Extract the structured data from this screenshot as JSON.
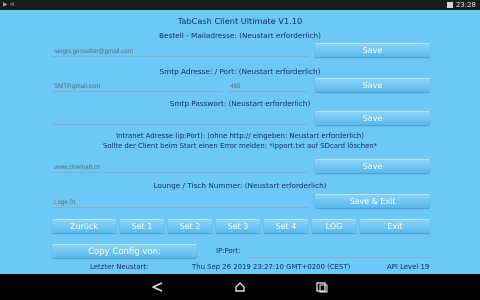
{
  "status_bar": {
    "left_icons": "▶ ⊲",
    "time": "23:28"
  },
  "title": "TabCash Client Ultimate V1.10",
  "email": {
    "label": "Bestell - Mailadresse: (Neustart erforderlich)",
    "value": "sergio.gensetter@gmail.com",
    "button": "Save"
  },
  "smtp": {
    "label": "Smtp Adresse: / Port: (Neustart erforderlich)",
    "address": "SMTP.gmail.com",
    "port": "465",
    "button": "Save"
  },
  "smtp_password": {
    "label": "Smtp Passwort: (Neustart erforderlich)",
    "value": "",
    "button": "Save"
  },
  "intranet": {
    "label_line1": "Intranet Adresse (ip:Port): (ohne http:// eingeben: Neustart erforderlich)",
    "label_line2": "Sollte der Client beim Start einen Error melden: *ipport.txt auf SDcard löschen*",
    "value": "www.cinema8.ch",
    "button": "Save"
  },
  "lounge": {
    "label": "Lounge / Tisch Nummer: (Neustart erforderlich)",
    "value": "Loge 01",
    "button": "Save & Exit"
  },
  "action_buttons": [
    "Zurück",
    "Set 1",
    "Set 2",
    "Set 3",
    "Set 4",
    "LOG",
    "Exit"
  ],
  "copy_config": {
    "button": "Copy Config von:",
    "ip_label": "IP:Port:"
  },
  "footer": {
    "last_restart_label": "Letzter Neustart:",
    "last_restart_value": "Thu Sep 26 2019 23:27:10 GMT+0200 (CEST)",
    "api_level": "API Level 19"
  }
}
